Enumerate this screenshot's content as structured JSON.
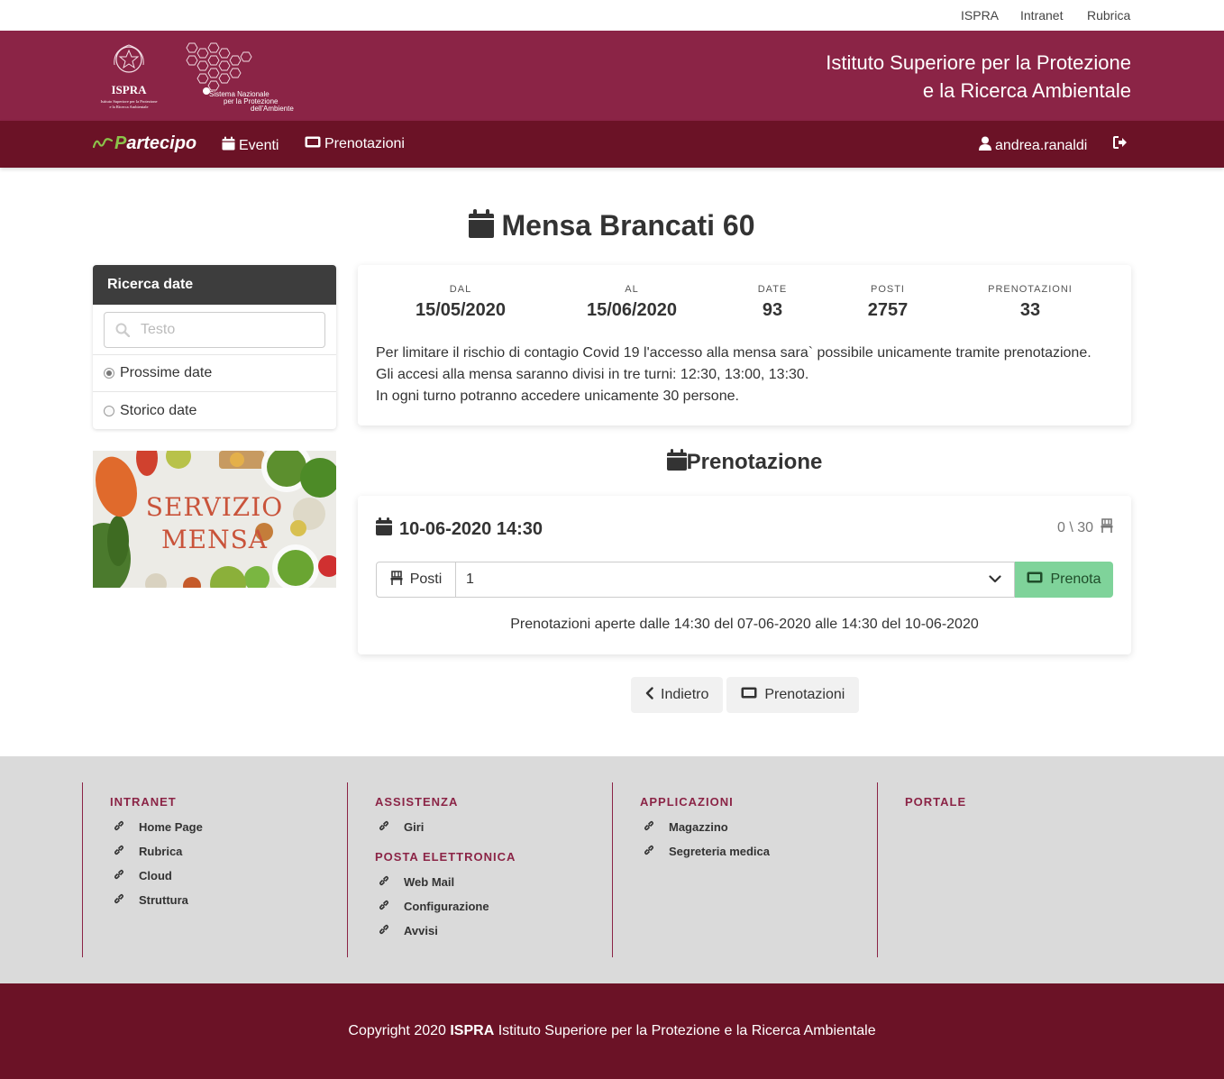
{
  "top_links": [
    "ISPRA",
    "Intranet",
    "Rubrica"
  ],
  "banner": {
    "logo_ispra": {
      "name": "ISPRA",
      "line1": "Istituto Superiore per la Protezione",
      "line2": "e la Ricerca Ambientale"
    },
    "logo_snpa": {
      "line1": "Sistema Nazionale",
      "line2": "per la Protezione",
      "line3": "dell'Ambiente"
    },
    "title_line1": "Istituto Superiore per la Protezione",
    "title_line2": "e la Ricerca Ambientale"
  },
  "navbar": {
    "brand_prefix": "P",
    "brand_rest": "artecipo",
    "eventi": "Eventi",
    "prenotazioni": "Prenotazioni",
    "user": "andrea.ranaldi"
  },
  "page_title": "Mensa Brancati 60",
  "sidebar": {
    "header": "Ricerca date",
    "search_placeholder": "Testo",
    "options": [
      {
        "label": "Prossime date",
        "selected": true
      },
      {
        "label": "Storico date",
        "selected": false
      }
    ]
  },
  "image": {
    "line1": "SERVIZIO",
    "line2": "MENSA"
  },
  "info": {
    "stats": [
      {
        "label": "DAL",
        "value": "15/05/2020"
      },
      {
        "label": "AL",
        "value": "15/06/2020"
      },
      {
        "label": "DATE",
        "value": "93"
      },
      {
        "label": "POSTI",
        "value": "2757"
      },
      {
        "label": "PRENOTAZIONI",
        "value": "33"
      }
    ],
    "text_lines": [
      "Per limitare il rischio di contagio Covid 19 l'accesso alla mensa sara` possibile unicamente tramite prenotazione.",
      "Gli accesi alla mensa saranno divisi in tre turni: 12:30, 13:00, 13:30.",
      "In ogni turno potranno accedere unicamente 30 persone."
    ]
  },
  "prenotazione": {
    "title": "Prenotazione",
    "slot_date": "10-06-2020 14:30",
    "slot_count": "0 \\ 30",
    "posti_label": "Posti",
    "posti_value": "1",
    "button": "Prenota",
    "note": "Prenotazioni aperte dalle 14:30 del 07-06-2020 alle 14:30 del 10-06-2020"
  },
  "buttons": {
    "back": "Indietro",
    "prenotazioni": "Prenotazioni"
  },
  "footer": {
    "col1": {
      "head": "INTRANET",
      "links": [
        "Home Page",
        "Rubrica",
        "Cloud",
        "Struttura"
      ]
    },
    "col2": {
      "head": "ASSISTENZA",
      "links": [
        "Giri"
      ],
      "head2": "POSTA ELETTRONICA",
      "links2": [
        "Web Mail",
        "Configurazione",
        "Avvisi"
      ]
    },
    "col3": {
      "head": "APPLICAZIONI",
      "links": [
        "Magazzino",
        "Segreteria medica"
      ]
    },
    "col4": {
      "head": "PORTALE"
    }
  },
  "copyright": {
    "prefix": "Copyright 2020 ",
    "brand": "ISPRA",
    "suffix": " Istituto Superiore per la Protezione e la Ricerca Ambientale"
  },
  "colors": {
    "banner": "#8b2446",
    "navbar": "#6b1226",
    "accent_green": "#7fd39a",
    "brand_green": "#8bc34a"
  }
}
